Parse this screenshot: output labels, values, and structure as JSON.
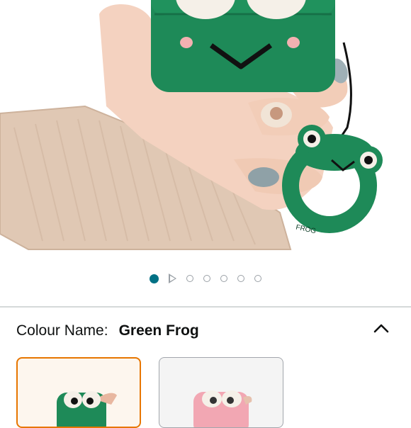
{
  "carousel": {
    "image_alt": "Green frog AirPods case held in hand",
    "ring_text": "FROG",
    "dot_count": 7,
    "active_index": 0,
    "video_index": 1
  },
  "variation": {
    "label": "Colour Name:",
    "selected_value": "Green Frog",
    "options": [
      {
        "name": "Green Frog",
        "color": "#1e8a58",
        "selected": true
      },
      {
        "name": "Pink Frog",
        "color": "#f2a7b3",
        "selected": false
      }
    ]
  },
  "colors": {
    "accent": "#007185",
    "selected_border": "#e77600",
    "case_green": "#1e8a58"
  },
  "icons": {
    "collapse": "chevron-up-icon",
    "video": "play-icon"
  }
}
